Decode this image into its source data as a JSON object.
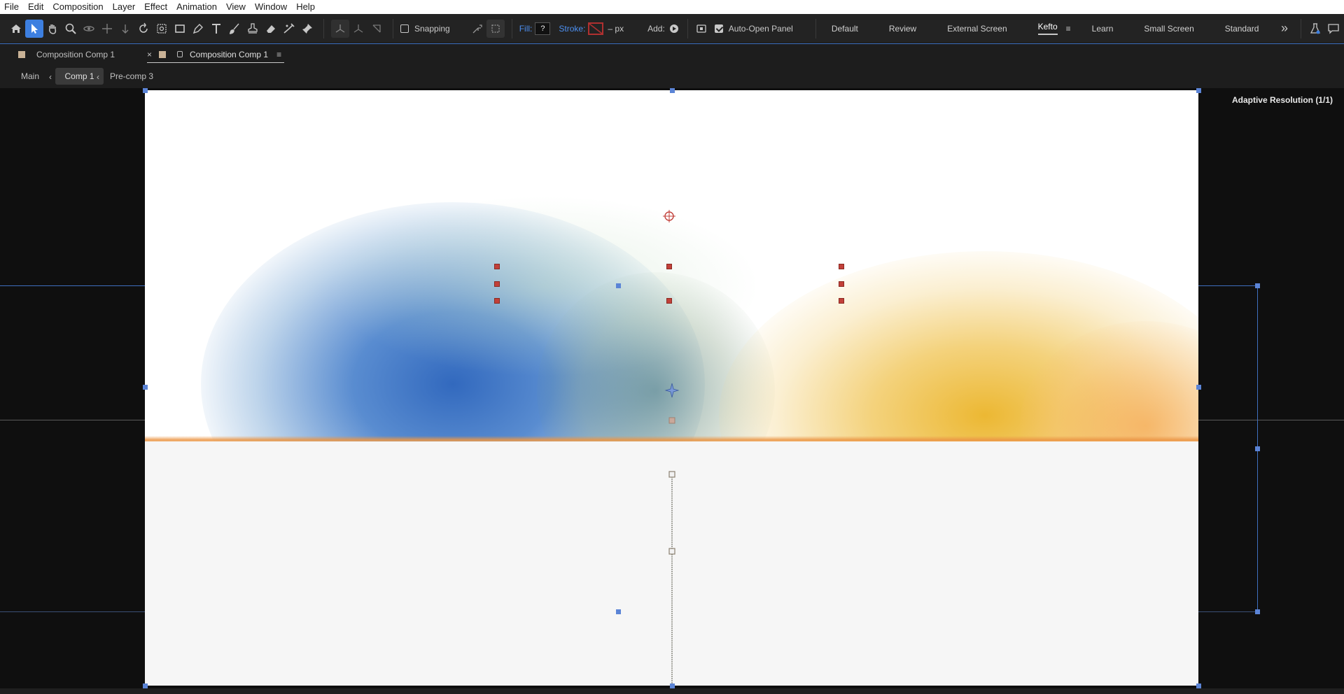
{
  "menu": [
    "File",
    "Edit",
    "Composition",
    "Layer",
    "Effect",
    "Animation",
    "View",
    "Window",
    "Help"
  ],
  "toolbar": {
    "snapping_label": "Snapping",
    "fill_label": "Fill:",
    "fill_value": "?",
    "stroke_label": "Stroke:",
    "stroke_unit": "– px",
    "add_label": "Add:",
    "auto_open_label": "Auto-Open Panel",
    "workspaces": [
      "Default",
      "Review",
      "External Screen",
      "Kefto",
      "Learn",
      "Small Screen",
      "Standard"
    ],
    "active_workspace": "Kefto",
    "overflow": "»"
  },
  "tabs": {
    "tab1": "Composition Comp 1",
    "tab2": "Composition Comp 1",
    "close": "×",
    "menu": "≡"
  },
  "breadcrumb": {
    "items": [
      "Main",
      "Comp 1",
      "Pre-comp 3"
    ],
    "active": "Comp 1"
  },
  "viewer": {
    "resolution": "Adaptive Resolution (1/1)"
  },
  "colors": {
    "accent": "#3d7fe0",
    "blob_blue": "#3a6fc0",
    "blob_yellow": "#f0b830",
    "handle_red": "#c2403a",
    "handle_blue": "#5b84d6"
  }
}
